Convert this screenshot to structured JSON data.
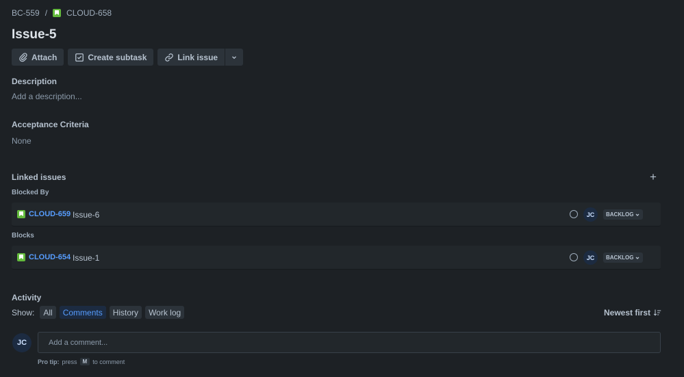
{
  "breadcrumb": {
    "parent": "BC-559",
    "separator": "/",
    "current": "CLOUD-658"
  },
  "issue": {
    "title": "Issue-5"
  },
  "toolbar": {
    "attach": "Attach",
    "create_subtask": "Create subtask",
    "link_issue": "Link issue"
  },
  "description": {
    "heading": "Description",
    "placeholder": "Add a description..."
  },
  "acceptance": {
    "heading": "Acceptance Criteria",
    "value": "None"
  },
  "linked": {
    "heading": "Linked issues",
    "groups": [
      {
        "label": "Blocked By",
        "items": [
          {
            "key": "CLOUD-659",
            "summary": "Issue-6",
            "assignee": "JC",
            "status": "BACKLOG"
          }
        ]
      },
      {
        "label": "Blocks",
        "items": [
          {
            "key": "CLOUD-654",
            "summary": "Issue-1",
            "assignee": "JC",
            "status": "BACKLOG"
          }
        ]
      }
    ]
  },
  "activity": {
    "heading": "Activity",
    "show_label": "Show:",
    "filters": [
      "All",
      "Comments",
      "History",
      "Work log"
    ],
    "active_filter": "Comments",
    "sort": "Newest first",
    "user_initials": "JC",
    "comment_placeholder": "Add a comment...",
    "protip_label": "Pro tip:",
    "protip_press": "press",
    "protip_key": "M",
    "protip_suffix": "to comment"
  },
  "colors": {
    "background": "#1d2125",
    "link": "#579dff",
    "story": "#63ba3c"
  }
}
